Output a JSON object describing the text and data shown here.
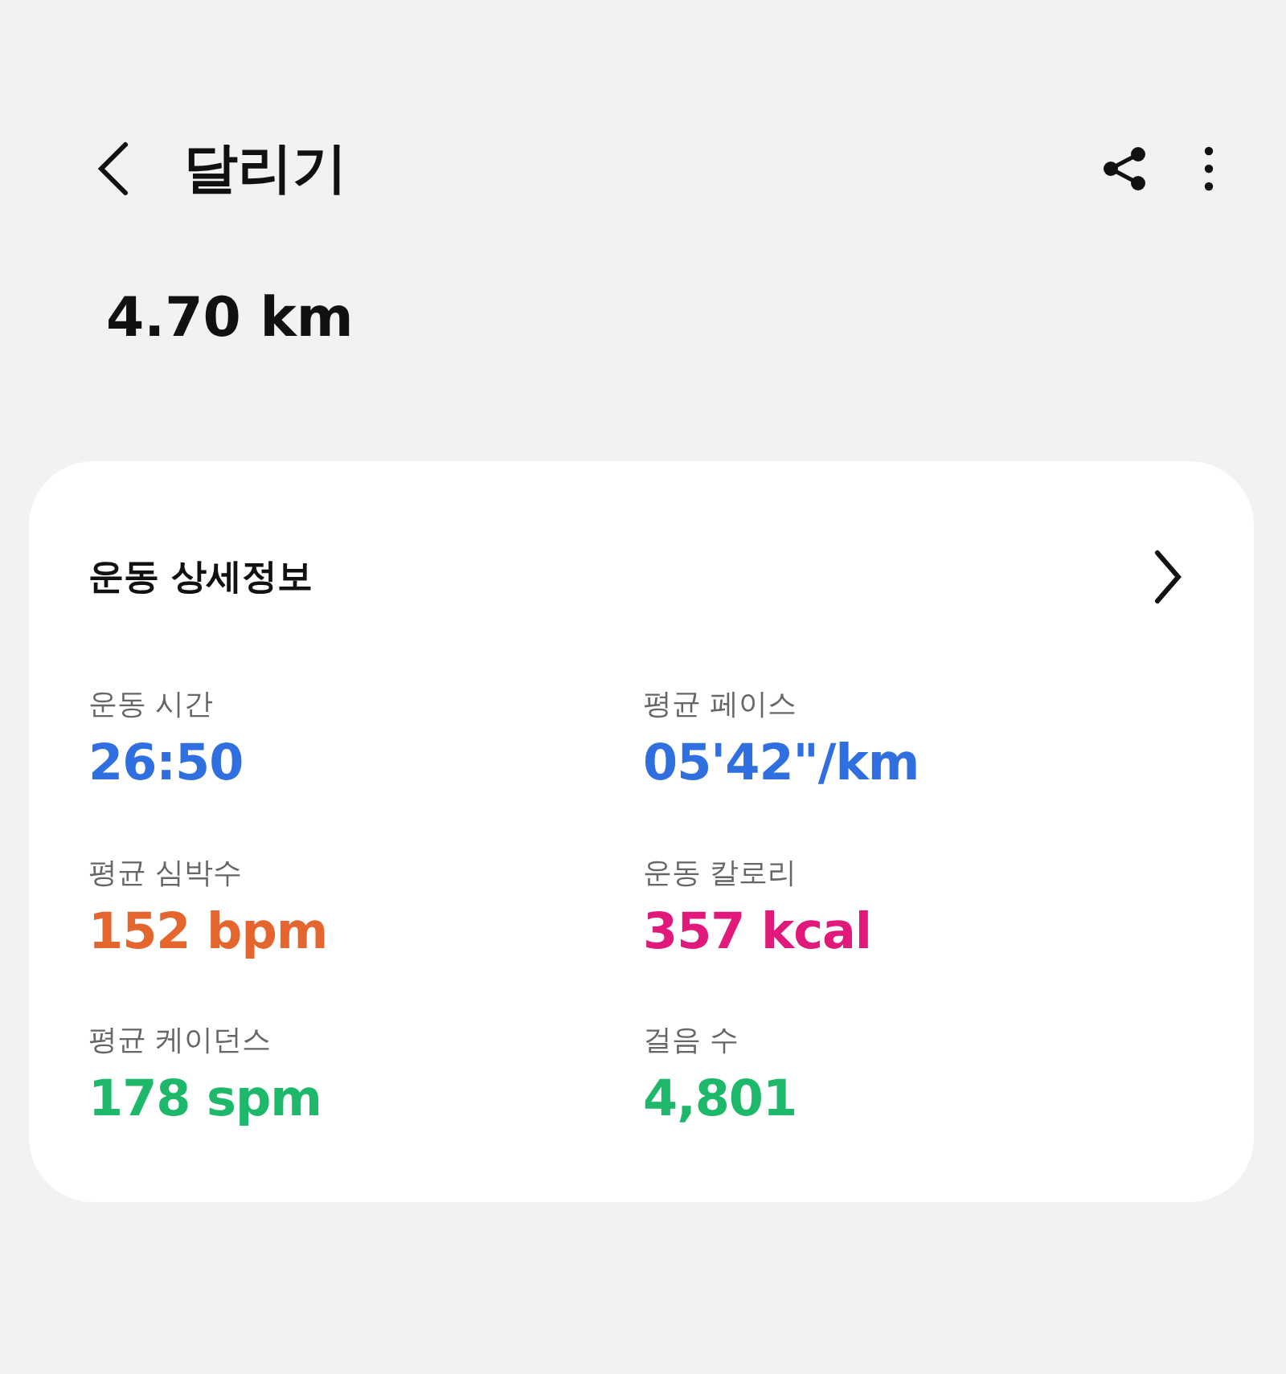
{
  "header": {
    "title": "달리기"
  },
  "distance": "4.70 km",
  "details": {
    "title": "운동 상세정보",
    "metrics": [
      {
        "label": "운동 시간",
        "value": "26:50",
        "color": "#2f6fdf"
      },
      {
        "label": "평균 페이스",
        "value": "05'42\"/km",
        "color": "#2f6fdf"
      },
      {
        "label": "평균 심박수",
        "value": "152 bpm",
        "color": "#e5652e"
      },
      {
        "label": "운동 칼로리",
        "value": "357 kcal",
        "color": "#e0197a"
      },
      {
        "label": "평균 케이던스",
        "value": "178 spm",
        "color": "#1db86a"
      },
      {
        "label": "걸음 수",
        "value": "4,801",
        "color": "#1db86a"
      }
    ]
  }
}
